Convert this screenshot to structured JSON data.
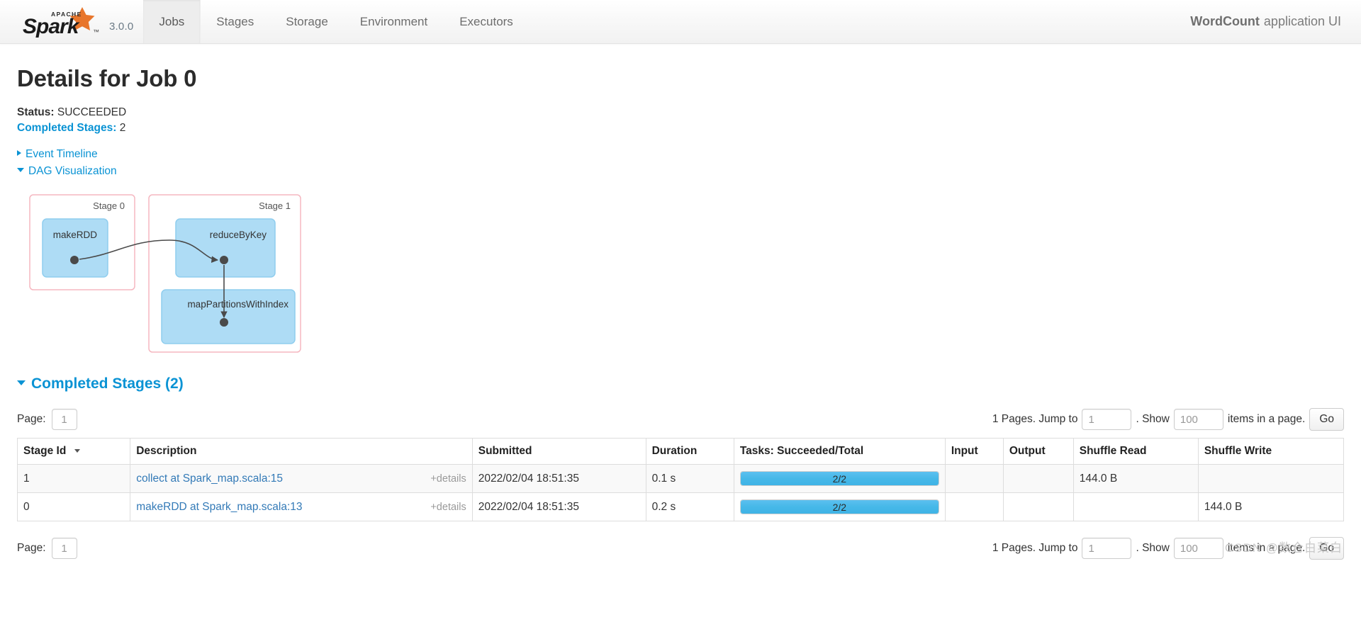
{
  "navbar": {
    "brand": {
      "name": "Apache Spark",
      "logo_icon": "spark-logo",
      "version": "3.0.0"
    },
    "tabs": [
      {
        "label": "Jobs",
        "active": true
      },
      {
        "label": "Stages",
        "active": false
      },
      {
        "label": "Storage",
        "active": false
      },
      {
        "label": "Environment",
        "active": false
      },
      {
        "label": "Executors",
        "active": false
      }
    ],
    "app_name": "WordCount",
    "app_suffix": "application UI"
  },
  "page": {
    "title": "Details for Job 0",
    "status_label": "Status:",
    "status_value": "SUCCEEDED",
    "completed_stages_label": "Completed Stages:",
    "completed_stages_value": "2",
    "event_timeline_label": "Event Timeline",
    "event_timeline_expanded": false,
    "dag_label": "DAG Visualization",
    "dag_expanded": true
  },
  "dag": {
    "stages": [
      {
        "title": "Stage 0",
        "nodes": [
          {
            "label": "makeRDD"
          }
        ]
      },
      {
        "title": "Stage 1",
        "nodes": [
          {
            "label": "reduceByKey"
          },
          {
            "label": "mapPartitionsWithIndex"
          }
        ]
      }
    ],
    "colors": {
      "stage_border": "#f5b7c0",
      "node_fill": "#aedcf5",
      "node_border": "#8fcdee",
      "edge": "#4a4a4a"
    }
  },
  "stages_section": {
    "header": "Completed Stages (2)",
    "expanded": true,
    "pager": {
      "page_label": "Page:",
      "page_value": "1",
      "pages_text": "1 Pages. Jump to",
      "jump_value": "1",
      "dot_show_text": ". Show",
      "show_value": "100",
      "items_text": "items in a page.",
      "go_label": "Go"
    },
    "columns": [
      "Stage Id",
      "Description",
      "Submitted",
      "Duration",
      "Tasks: Succeeded/Total",
      "Input",
      "Output",
      "Shuffle Read",
      "Shuffle Write"
    ],
    "sorted_column": "Stage Id",
    "rows": [
      {
        "stage_id": "1",
        "description": "collect at Spark_map.scala:15",
        "details_label": "+details",
        "submitted": "2022/02/04 18:51:35",
        "duration": "0.1 s",
        "tasks_label": "2/2",
        "tasks_percent": 100,
        "input": "",
        "output": "",
        "shuffle_read": "144.0 B",
        "shuffle_write": ""
      },
      {
        "stage_id": "0",
        "description": "makeRDD at Spark_map.scala:13",
        "details_label": "+details",
        "submitted": "2022/02/04 18:51:35",
        "duration": "0.2 s",
        "tasks_label": "2/2",
        "tasks_percent": 100,
        "input": "",
        "output": "",
        "shuffle_read": "",
        "shuffle_write": "144.0 B"
      }
    ]
  },
  "watermark": "CSDN @数仓白菜白"
}
